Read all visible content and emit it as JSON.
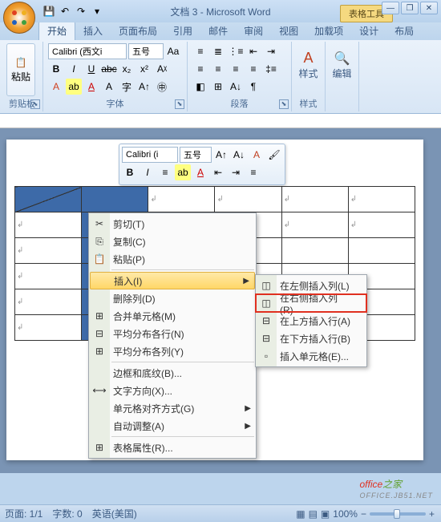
{
  "title": "文档 3 - Microsoft Word",
  "context_tool": "表格工具",
  "tabs": {
    "home": "开始",
    "insert": "插入",
    "layout": "页面布局",
    "ref": "引用",
    "mail": "邮件",
    "review": "审阅",
    "view": "视图",
    "addin": "加载项",
    "design": "设计",
    "tlayout": "布局"
  },
  "ribbon": {
    "paste": "粘贴",
    "clipboard": "剪贴板",
    "font_name": "Calibri (西文i",
    "font_size": "五号",
    "font_label": "字体",
    "para_label": "段落",
    "styles": "样式",
    "edit": "编辑"
  },
  "mini": {
    "font": "Calibri (i",
    "size": "五号"
  },
  "menu": {
    "cut": "剪切(T)",
    "copy": "复制(C)",
    "paste": "粘贴(P)",
    "insert": "插入(I)",
    "delete": "删除列(D)",
    "merge": "合并单元格(M)",
    "dist_rows": "平均分布各行(N)",
    "dist_cols": "平均分布各列(Y)",
    "borders": "边框和底纹(B)...",
    "text_dir": "文字方向(X)...",
    "align": "单元格对齐方式(G)",
    "autofit": "自动调整(A)",
    "props": "表格属性(R)..."
  },
  "submenu": {
    "ins_left": "在左侧插入列(L)",
    "ins_right": "在右侧插入列(R)",
    "ins_above": "在上方插入行(A)",
    "ins_below": "在下方插入行(B)",
    "ins_cell": "插入单元格(E)..."
  },
  "status": {
    "page": "页面: 1/1",
    "words": "字数: 0",
    "lang": "英语(美国)",
    "zoom": "100%"
  },
  "watermark": {
    "a": "office",
    "b": "之家",
    "url": "OFFICE.JB51.NET"
  }
}
